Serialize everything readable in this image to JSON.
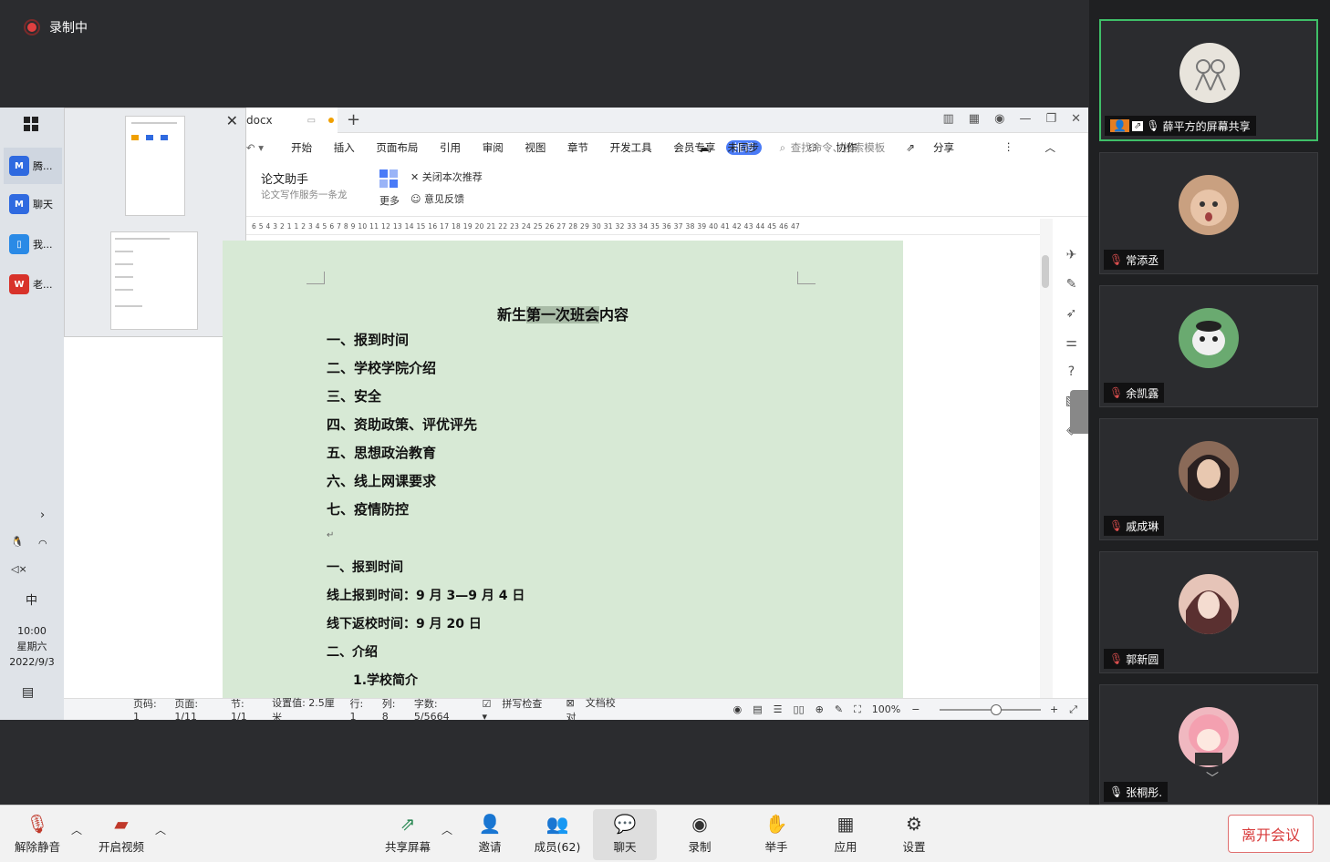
{
  "recording": {
    "label": "录制中"
  },
  "taskbar": {
    "items": [
      {
        "label": "腾...",
        "color": "#2f6ae0",
        "icon": "tencent-meeting-icon"
      },
      {
        "label": "聊天",
        "color": "#2f6ae0",
        "icon": "chat-app-icon"
      },
      {
        "label": "我...",
        "color": "#2a8ae6",
        "icon": "phone-app-icon"
      },
      {
        "label": "老...",
        "color": "#d8322a",
        "icon": "wps-icon"
      }
    ],
    "ime": "中",
    "time": "10:00",
    "weekday": "星期六",
    "date": "2022/9/3"
  },
  "wps": {
    "doc_tab": "docx",
    "menu": [
      "开始",
      "插入",
      "页面布局",
      "引用",
      "审阅",
      "视图",
      "章节",
      "开发工具",
      "会员专享"
    ],
    "menu_highlight": "推荐",
    "search_placeholder": "查找命令、搜索模板",
    "menu_right": [
      "未同步",
      "协作",
      "分享"
    ],
    "ribbon": {
      "title": "论文助手",
      "subtitle": "论文写作服务一条龙",
      "more": "更多",
      "close_recommend": "关闭本次推荐",
      "feedback": "意见反馈"
    },
    "ruler": "6 5 4 3 2 1  1 2 3 4 5 6 7 8 9 10 11 12 13 14 15 16 17 18 19 20 21 22 23 24 25 26 27 28 29 30 31 32 33 34 35 36 37 38 39 40 41 42 43 44 45 46 47",
    "document": {
      "title_pre": "新生",
      "title_hl": "第一次班会",
      "title_post": "内容",
      "outline": [
        "一、报到时间",
        "二、学校学院介绍",
        "三、安全",
        "四、资助政策、评优评先",
        "五、思想政治教育",
        "六、线上网课要求",
        "七、疫情防控"
      ],
      "body": [
        "一、报到时间",
        "线上报到时间：9 月 3—9 月 4 日",
        "线下返校时间：9 月 20 日",
        "二、介绍",
        "1.学校简介"
      ]
    },
    "status": {
      "page_num": "页码: 1",
      "pages": "页面: 1/11",
      "section": "节: 1/1",
      "setting": "设置值: 2.5厘米",
      "row": "行: 1",
      "col": "列: 8",
      "words": "字数: 5/5664",
      "spell": "拼写检查",
      "proof": "文档校对",
      "zoom": "100%"
    }
  },
  "participants": [
    {
      "name": "薛平方的屏幕共享",
      "muted": false,
      "active": true,
      "avatar_color": "#e8e4dc",
      "avatar_fg": "#777"
    },
    {
      "name": "常添丞",
      "muted": true,
      "active": false,
      "avatar_color": "#c9a080",
      "avatar_fg": "#6a4a3a"
    },
    {
      "name": "余凯露",
      "muted": true,
      "active": false,
      "avatar_color": "#6aaa70",
      "avatar_fg": "#f0f0f0"
    },
    {
      "name": "戚成琳",
      "muted": true,
      "active": false,
      "avatar_color": "#8a6a58",
      "avatar_fg": "#2a2020"
    },
    {
      "name": "郭新圆",
      "muted": true,
      "active": false,
      "avatar_color": "#e6c4b8",
      "avatar_fg": "#5a3030"
    },
    {
      "name": "张桐彤.",
      "muted": false,
      "active": false,
      "avatar_color": "#f0b8c0",
      "avatar_fg": "#c06070"
    }
  ],
  "bottombar": {
    "unmute": "解除静音",
    "video": "开启视频",
    "share": "共享屏幕",
    "invite": "邀请",
    "members": "成员(62)",
    "chat": "聊天",
    "record": "录制",
    "raise_hand": "举手",
    "apps": "应用",
    "settings": "设置",
    "leave": "离开会议"
  },
  "colors": {
    "accent_blue": "#4a7bf7",
    "doc_bg": "#d7e9d5",
    "leave_red": "#d83b3b",
    "active_green": "#3fbf68"
  }
}
